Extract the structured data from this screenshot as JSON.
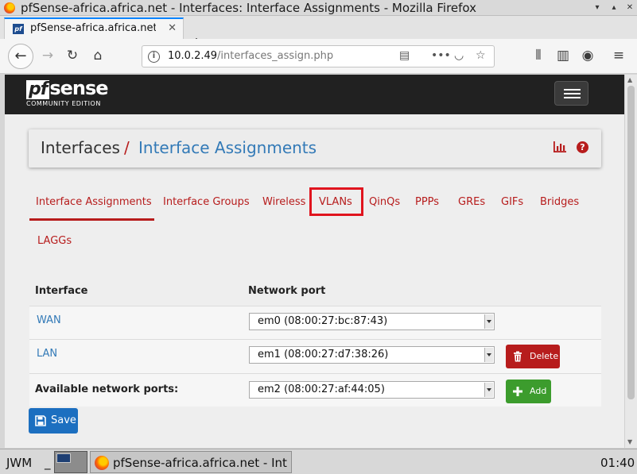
{
  "window": {
    "title": "pfSense-africa.africa.net - Interfaces: Interface Assignments - Mozilla Firefox",
    "controls": [
      "minimize",
      "maximize",
      "close"
    ]
  },
  "browser": {
    "tab_label": "pfSense-africa.africa.net",
    "tab_favicon_text": "pf",
    "url_host": "10.0.2.49",
    "url_path": "/interfaces_assign.php"
  },
  "pfsense": {
    "logo_pf": "pf",
    "logo_sense": "sense",
    "edition": "COMMUNITY EDITION"
  },
  "header": {
    "crumb_parent": "Interfaces",
    "separator": "/",
    "crumb_current": "Interface Assignments"
  },
  "tabs": [
    {
      "label": "Interface Assignments",
      "active": true
    },
    {
      "label": "Interface Groups"
    },
    {
      "label": "Wireless"
    },
    {
      "label": "VLANs",
      "highlighted": true
    },
    {
      "label": "QinQs"
    },
    {
      "label": "PPPs"
    },
    {
      "label": "GREs"
    },
    {
      "label": "GIFs"
    },
    {
      "label": "Bridges"
    },
    {
      "label": "LAGGs"
    }
  ],
  "table": {
    "columns": [
      "Interface",
      "Network port"
    ],
    "rows": [
      {
        "interface": "WAN",
        "port": "em0 (08:00:27:bc:87:43)"
      },
      {
        "interface": "LAN",
        "port": "em1 (08:00:27:d7:38:26)",
        "action": "Delete"
      }
    ],
    "available": {
      "label": "Available network ports:",
      "port": "em2 (08:00:27:af:44:05)",
      "action": "Add"
    }
  },
  "save_label": "Save",
  "taskbar": {
    "menu": "JWM",
    "separator": "_",
    "task_title": "pfSense-africa.africa.net - Int",
    "clock": "01:40"
  },
  "colors": {
    "brand_red": "#b71c1c",
    "link_blue": "#337ab7",
    "success_green": "#3c9c2d",
    "primary_blue": "#1c6fc0",
    "highlight_box": "#e0141e"
  }
}
